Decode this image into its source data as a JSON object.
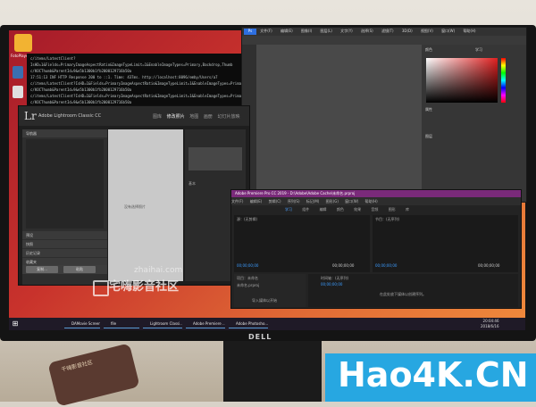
{
  "desktop": {
    "icon_label": "FotoPlayer..."
  },
  "cmd": {
    "lines": [
      "c/items/LatestClient?IsHD=1&Fields=PrimaryImageAspectRatio&ImageTypeLimit=1&EnableImageTypes=Primary,Backdrop,Thumb",
      "c/KOCThumb&ParentId=9&e5b1300b1fb2000129716b50a",
      "17:51:13 INF HTTP Response 200 to ::1. Time: 437ms. http://localhost:8096/emby/Users/a7",
      "c/items/LatestClient?IsHD=1&Fields=PrimaryImageAspectRatio&ImageTypeLimit=1&EnableImageTypes=Primary",
      "c/KOCThumb&ParentId=9&e5b1300b1fb2000129716b50a",
      "c/items/LatestClient?IsHD=1&Fields=PrimaryImageAspectRatio&ImageTypeLimit=1&EnableImageTypes=Primary",
      "c/KOCThumb&ParentId=9&e5b1300b1fb2000129716b50a"
    ]
  },
  "photoshop": {
    "menu": [
      "文件(F)",
      "编辑(E)",
      "图像(I)",
      "图层(L)",
      "文字(Y)",
      "选择(S)",
      "滤镜(T)",
      "3D(D)",
      "视图(V)",
      "窗口(W)",
      "帮助(H)"
    ],
    "panel_color": "颜色",
    "panel_learn": "学习",
    "panel_props": "属性",
    "panel_layers": "图层"
  },
  "lightroom": {
    "logo": "Lr",
    "name": "Adobe Lightroom Classic CC",
    "modules": [
      "图库",
      "修改照片",
      "地图",
      "画册",
      "幻灯片放映"
    ],
    "left_sections": [
      "导航器",
      "预设",
      "快照",
      "历史记录",
      "收藏夹"
    ],
    "nav_fit": "适合",
    "center_text": "没有选择照片",
    "btn_copy": "复制...",
    "btn_paste": "粘贴",
    "right_label": "基本"
  },
  "premiere": {
    "title": "Adobe Premiere Pro CC 2019 - D:\\Adobe\\Adobe Cache\\未命名.prproj",
    "menu": [
      "文件(F)",
      "编辑(E)",
      "剪辑(C)",
      "序列(S)",
      "标记(M)",
      "图形(G)",
      "窗口(W)",
      "帮助(H)"
    ],
    "workspaces": [
      "学习",
      "组件",
      "编辑",
      "颜色",
      "效果",
      "音频",
      "图形",
      "库"
    ],
    "source_label": "源：(无剪辑)",
    "program_label": "节目：(无序列)",
    "timecode": "00;00;00;00",
    "project_label": "项目：未命名",
    "project_file": "未命名.prproj",
    "timeline_label": "时间轴：(无序列)",
    "timeline_hint": "在此处放下媒体以创建序列。",
    "import_hint": "导入媒体以开始"
  },
  "taskbar": {
    "items": [
      "DAMovie Screen...",
      "file",
      "Lightroom Classi...",
      "Adobe Premiere ...",
      "Adobe Photosho..."
    ],
    "time": "20:04:46",
    "date": "2018/6/16"
  },
  "watermark": {
    "url": "zhaihai.com",
    "text": "宅嗨影音社区"
  },
  "monitor_brand": "DELL",
  "coaster_text": "千嗨影音社区",
  "site_brand": "Hao4K.CN",
  "colors": {
    "wallpaper_start": "#a51b2a",
    "wallpaper_end": "#f08a3c",
    "brand_blue": "#27a7e1",
    "premiere_title": "#7a2a7a"
  }
}
